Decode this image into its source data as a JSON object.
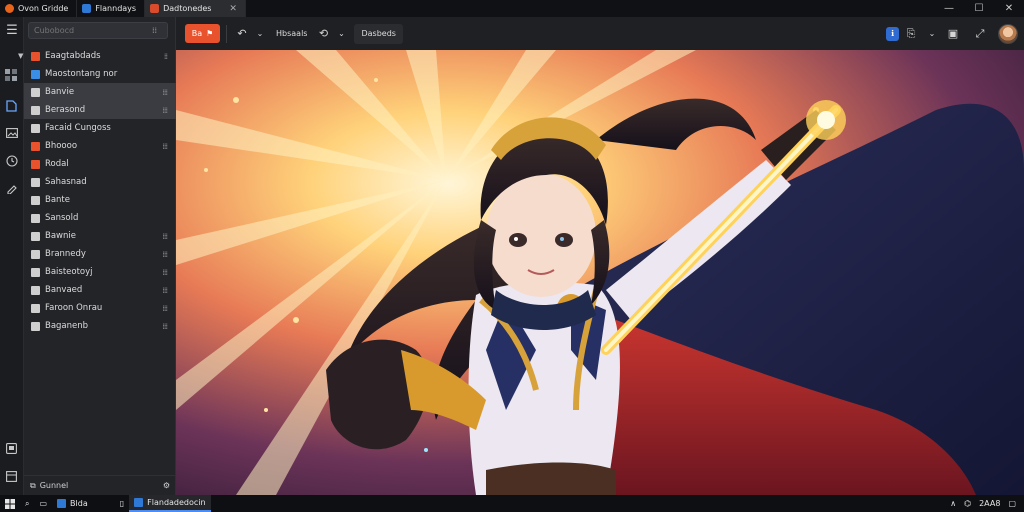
{
  "tabs": [
    {
      "label": "Ovon Gridde",
      "icon": "app-orange-icon",
      "color": "#e8641b"
    },
    {
      "label": "Flanndays",
      "icon": "app-blue-icon",
      "color": "#2f79d6"
    },
    {
      "label": "Dadtonedes",
      "icon": "app-red-icon",
      "color": "#d94b2b"
    }
  ],
  "sidebar": {
    "search_placeholder": "Cubobocd",
    "items": [
      {
        "label": "Eaagtabdads",
        "color": "#e8532d"
      },
      {
        "label": "Maostontang nor",
        "color": "#3a8ee6"
      },
      {
        "label": "Banvie",
        "color": "#cfcfcf"
      },
      {
        "label": "Berasond",
        "color": "#cfcfcf"
      },
      {
        "label": "Facaid Cungoss",
        "color": "#cfcfcf"
      },
      {
        "label": "Bhoooo",
        "color": "#e8532d"
      },
      {
        "label": "Rodal",
        "color": "#e8532d"
      },
      {
        "label": "Sahasnad",
        "color": "#cfcfcf"
      },
      {
        "label": "Bante",
        "color": "#cfcfcf"
      },
      {
        "label": "Sansold",
        "color": "#cfcfcf"
      },
      {
        "label": "Bawnie",
        "color": "#cfcfcf"
      },
      {
        "label": "Brannedy",
        "color": "#cfcfcf"
      },
      {
        "label": "Baisteotoyj",
        "color": "#cfcfcf"
      },
      {
        "label": "Banvaed",
        "color": "#cfcfcf"
      },
      {
        "label": "Faroon Onrau",
        "color": "#cfcfcf"
      },
      {
        "label": "Baganenb",
        "color": "#cfcfcf"
      }
    ],
    "footer_label": "Gunnel"
  },
  "toolbar": {
    "primary_label": "Ba",
    "version_label": "Hbsaals",
    "location_label": "Dasbeds"
  },
  "taskbar": {
    "apps": [
      {
        "label": "Blda",
        "color": "#2f79d6"
      },
      {
        "label": "Flandadedocin",
        "color": "#2f79d6"
      }
    ],
    "clock": "2AA8"
  }
}
